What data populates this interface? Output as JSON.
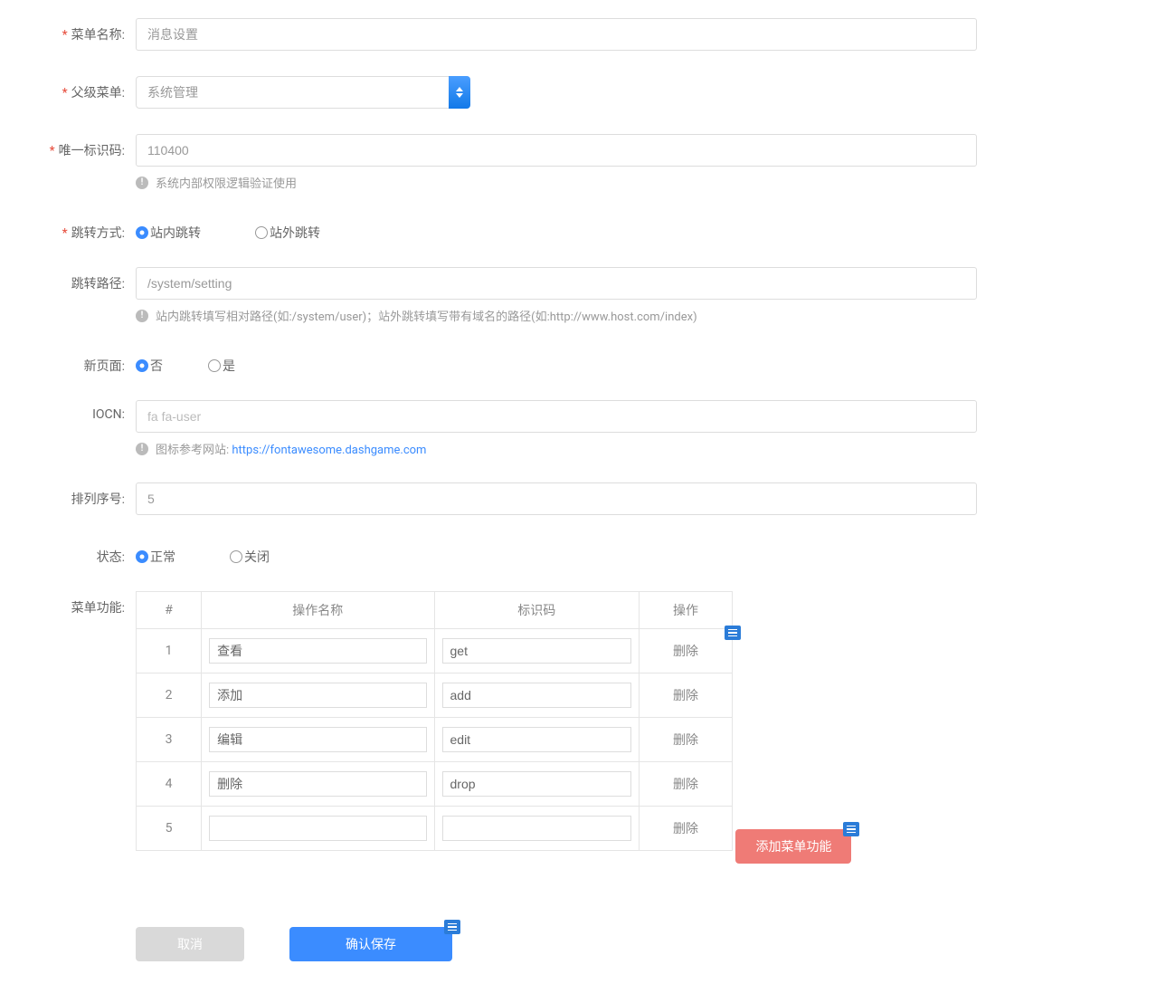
{
  "labels": {
    "menuName": "菜单名称:",
    "parentMenu": "父级菜单:",
    "uniqueCode": "唯一标识码:",
    "jumpMode": "跳转方式:",
    "jumpPath": "跳转路径:",
    "newPage": "新页面:",
    "icon": "IOCN:",
    "sortNo": "排列序号:",
    "status": "状态:",
    "menuFunc": "菜单功能:"
  },
  "values": {
    "menuName": "消息设置",
    "parentMenu": "系统管理",
    "uniqueCode": "110400",
    "jumpPath": "/system/setting",
    "iconPlaceholder": "fa fa-user",
    "sortNo": "5"
  },
  "hints": {
    "uniqueCode": "系统内部权限逻辑验证使用",
    "jumpPath": "站内跳转填写相对路径(如:/system/user)；站外跳转填写带有域名的路径(如:http://www.host.com/index)",
    "iconPrefix": "图标参考网站:",
    "iconLink": "https://fontawesome.dashgame.com"
  },
  "radios": {
    "jumpMode": {
      "opt1": "站内跳转",
      "opt2": "站外跳转"
    },
    "newPage": {
      "opt1": "否",
      "opt2": "是"
    },
    "status": {
      "opt1": "正常",
      "opt2": "关闭"
    }
  },
  "table": {
    "headers": {
      "idx": "#",
      "name": "操作名称",
      "code": "标识码",
      "action": "操作"
    },
    "deleteLabel": "删除",
    "rows": [
      {
        "idx": "1",
        "name": "查看",
        "code": "get"
      },
      {
        "idx": "2",
        "name": "添加",
        "code": "add"
      },
      {
        "idx": "3",
        "name": "编辑",
        "code": "edit"
      },
      {
        "idx": "4",
        "name": "删除",
        "code": "drop"
      },
      {
        "idx": "5",
        "name": "",
        "code": ""
      }
    ]
  },
  "buttons": {
    "addFunc": "添加菜单功能",
    "cancel": "取消",
    "save": "确认保存"
  }
}
